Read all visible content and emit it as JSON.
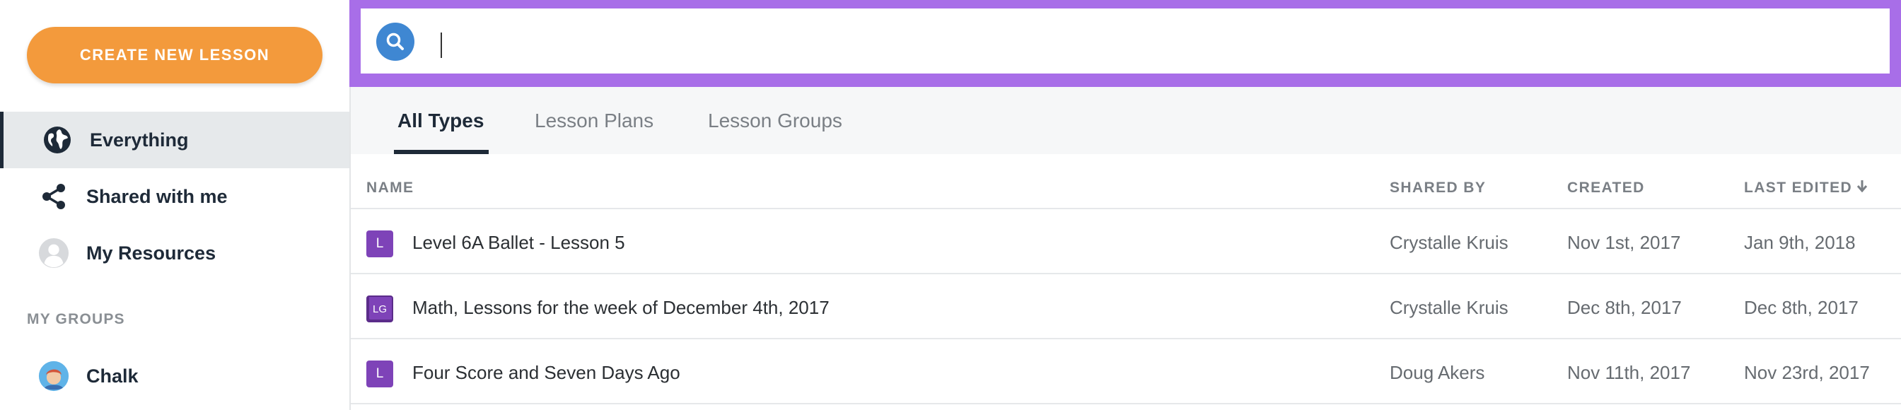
{
  "sidebar": {
    "create_button": "CREATE NEW LESSON",
    "nav": [
      {
        "label": "Everything",
        "icon": "globe-icon",
        "active": true
      },
      {
        "label": "Shared with me",
        "icon": "share-icon",
        "active": false
      },
      {
        "label": "My Resources",
        "icon": "user-avatar-icon",
        "active": false
      }
    ],
    "groups_heading": "MY GROUPS",
    "groups": [
      {
        "label": "Chalk",
        "icon": "group-avatar-icon"
      }
    ]
  },
  "search": {
    "value": "",
    "placeholder": ""
  },
  "tabs": [
    {
      "label": "All Types",
      "active": true
    },
    {
      "label": "Lesson Plans",
      "active": false
    },
    {
      "label": "Lesson Groups",
      "active": false
    }
  ],
  "table": {
    "columns": [
      "NAME",
      "SHARED BY",
      "CREATED",
      "LAST EDITED"
    ],
    "sort_icon": "arrow-down-icon",
    "rows": [
      {
        "badge": "L",
        "name": "Level 6A Ballet - Lesson 5",
        "shared_by": "Crystalle Kruis",
        "created": "Nov 1st, 2017",
        "last_edited": "Jan 9th, 2018"
      },
      {
        "badge": "LG",
        "name": "Math, Lessons for the week of December 4th, 2017",
        "shared_by": "Crystalle Kruis",
        "created": "Dec 8th, 2017",
        "last_edited": "Dec 8th, 2017"
      },
      {
        "badge": "L",
        "name": "Four Score and Seven Days Ago",
        "shared_by": "Doug Akers",
        "created": "Nov 11th, 2017",
        "last_edited": "Nov 23rd, 2017"
      }
    ]
  },
  "colors": {
    "accent_orange": "#f39a3c",
    "search_border_purple": "#a86ee8",
    "search_icon_blue": "#3f87d2",
    "badge_purple": "#7e43b8",
    "nav_dark": "#1e2a38"
  }
}
